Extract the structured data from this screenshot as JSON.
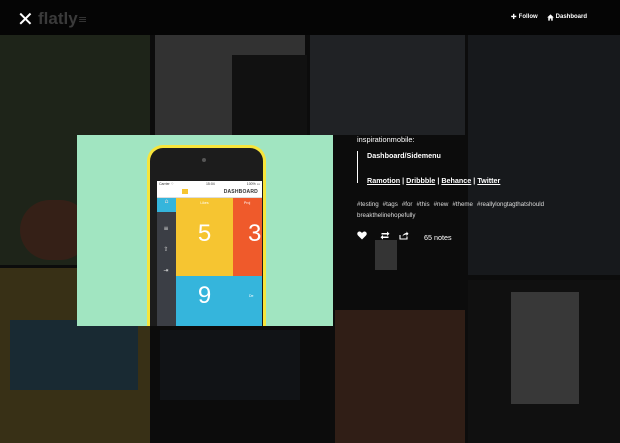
{
  "header": {
    "logo_text": "flatly",
    "menu_glyph": "≡",
    "close_glyph": "✕",
    "follow_label": "Follow",
    "follow_icon": "plus-icon",
    "dashboard_label": "Dashboard",
    "dashboard_icon": "home-icon"
  },
  "post": {
    "blog_name": "inspirationmobile:",
    "quote_title": "Dashboard/Sidemenu",
    "credit_links": [
      "Ramotion",
      "Dribbble",
      "Behance",
      "Twitter"
    ],
    "separator": "|",
    "tags": [
      "#testing",
      "#tags",
      "#for",
      "#this",
      "#new",
      "#theme",
      "#reallylongtagthatshouldbreakthelinehopefully"
    ],
    "notes": "65 notes",
    "action_icons": [
      "heart-icon",
      "reblog-icon",
      "share-icon"
    ]
  },
  "phone_screen": {
    "status_left": "Carrier ⌔",
    "status_time": "15:04",
    "status_right": "100% ▭",
    "title": "DASHBOARD",
    "cells": [
      {
        "label": "Likes",
        "value": "5",
        "color": "#f6c531"
      },
      {
        "label": "Proj",
        "value": "3",
        "color": "#ef5a2b"
      },
      {
        "label": "",
        "value": "9",
        "color": "#35b5dc"
      },
      {
        "label": "De",
        "value": "",
        "color": "#35b5dc"
      }
    ]
  },
  "colors": {
    "overlay_text": "#ffffff",
    "photo_bg": "#a1e5c1",
    "phone_body": "#f7e53b",
    "sidebar": "#3b3e45"
  }
}
